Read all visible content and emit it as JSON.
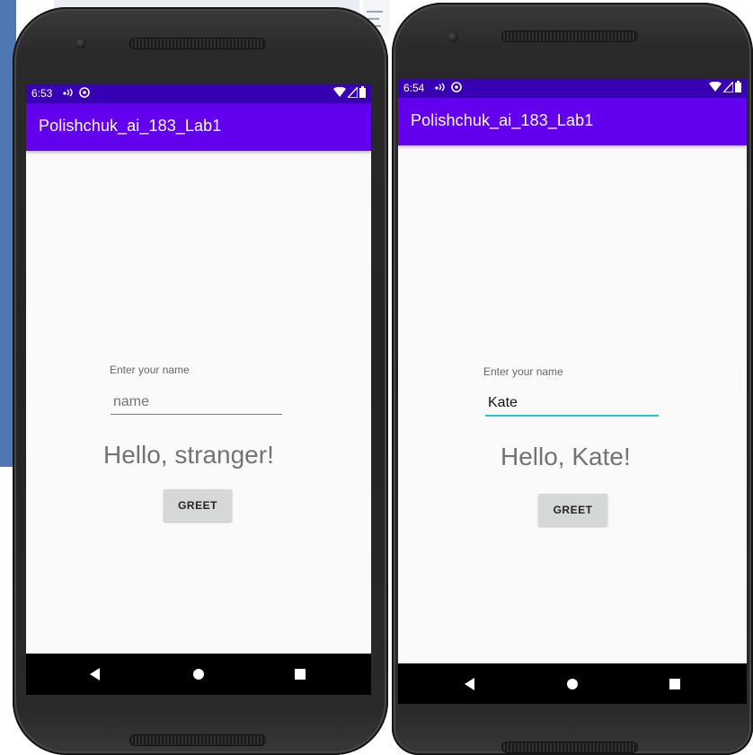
{
  "colors": {
    "status_bar": "#3700b3",
    "app_bar": "#6200ee",
    "accent_underline": "#26c6da",
    "screen_bg": "#fafafa",
    "nav_bar": "#000000"
  },
  "phones": [
    {
      "status_bar": {
        "time": "6:53"
      },
      "app_bar": {
        "title": "Polishchuk_ai_183_Lab1"
      },
      "name_label": "Enter your name",
      "name_input": {
        "value": "",
        "placeholder": "name",
        "focused": false
      },
      "greeting": "Hello, stranger!",
      "greet_button_label": "GREET",
      "nav_icons": [
        "back-icon",
        "home-icon",
        "recents-icon"
      ]
    },
    {
      "status_bar": {
        "time": "6:54"
      },
      "app_bar": {
        "title": "Polishchuk_ai_183_Lab1"
      },
      "name_label": "Enter your name",
      "name_input": {
        "value": "Kate",
        "placeholder": "name",
        "focused": true
      },
      "greeting": "Hello, Kate!",
      "greet_button_label": "GREET",
      "nav_icons": [
        "back-icon",
        "home-icon",
        "recents-icon"
      ]
    }
  ]
}
